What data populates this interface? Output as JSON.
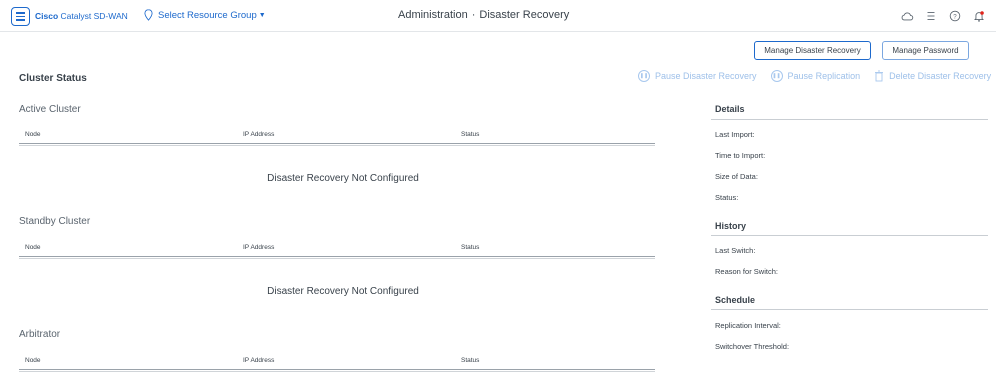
{
  "header": {
    "brand_bold": "Cisco",
    "brand_rest": "Catalyst SD-WAN",
    "resource_group": "Select Resource Group",
    "title_section": "Administration",
    "title_separator": "·",
    "title_page": "Disaster Recovery",
    "icons": [
      "cloud-icon",
      "list-icon",
      "help-icon",
      "bell-icon"
    ],
    "alert_color": "#e2231a"
  },
  "buttons": {
    "manage_dr": "Manage Disaster Recovery",
    "manage_password": "Manage Password"
  },
  "cluster_status": {
    "title": "Cluster Status",
    "actions": {
      "pause_dr": "Pause Disaster Recovery",
      "pause_replication": "Pause Replication",
      "delete_dr": "Delete Disaster Recovery"
    },
    "columns": {
      "node": "Node",
      "ip": "IP Address",
      "status": "Status"
    },
    "active": {
      "heading": "Active Cluster",
      "empty": "Disaster Recovery Not Configured"
    },
    "standby": {
      "heading": "Standby Cluster",
      "empty": "Disaster Recovery Not Configured"
    },
    "arbitrator": {
      "heading": "Arbitrator"
    }
  },
  "details": {
    "heading": "Details",
    "last_import": "Last Import:",
    "time_to_import": "Time to Import:",
    "size_of_data": "Size of Data:",
    "status": "Status:"
  },
  "history": {
    "heading": "History",
    "last_switch": "Last Switch:",
    "reason": "Reason for Switch:"
  },
  "schedule": {
    "heading": "Schedule",
    "replication_interval": "Replication Interval:",
    "switchover_threshold": "Switchover Threshold:"
  },
  "colors": {
    "accent": "#1d69cc",
    "disabled_action": "#9ec0e9",
    "text": "#39424b"
  }
}
